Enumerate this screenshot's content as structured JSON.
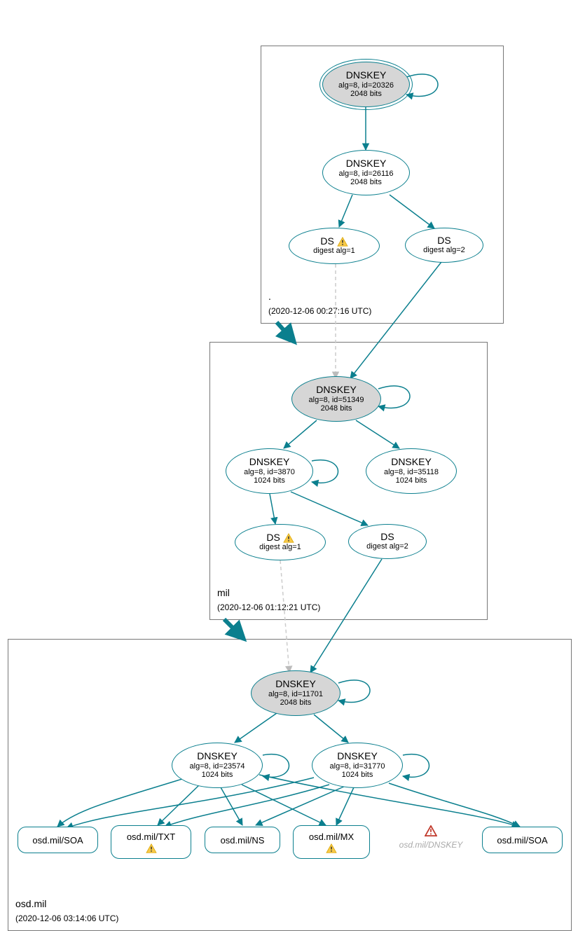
{
  "zones": {
    "root": {
      "label": ".",
      "timestamp": "(2020-12-06 00:27:16 UTC)"
    },
    "mil": {
      "label": "mil",
      "timestamp": "(2020-12-06 01:12:21 UTC)"
    },
    "osd": {
      "label": "osd.mil",
      "timestamp": "(2020-12-06 03:14:06 UTC)"
    }
  },
  "nodes": {
    "root_ksk": {
      "title": "DNSKEY",
      "line1": "alg=8, id=20326",
      "line2": "2048 bits"
    },
    "root_zsk": {
      "title": "DNSKEY",
      "line1": "alg=8, id=26116",
      "line2": "2048 bits"
    },
    "root_ds1": {
      "title": "DS",
      "line1": "digest alg=1"
    },
    "root_ds2": {
      "title": "DS",
      "line1": "digest alg=2"
    },
    "mil_ksk": {
      "title": "DNSKEY",
      "line1": "alg=8, id=51349",
      "line2": "2048 bits"
    },
    "mil_zsk1": {
      "title": "DNSKEY",
      "line1": "alg=8, id=3870",
      "line2": "1024 bits"
    },
    "mil_zsk2": {
      "title": "DNSKEY",
      "line1": "alg=8, id=35118",
      "line2": "1024 bits"
    },
    "mil_ds1": {
      "title": "DS",
      "line1": "digest alg=1"
    },
    "mil_ds2": {
      "title": "DS",
      "line1": "digest alg=2"
    },
    "osd_ksk": {
      "title": "DNSKEY",
      "line1": "alg=8, id=11701",
      "line2": "2048 bits"
    },
    "osd_zsk1": {
      "title": "DNSKEY",
      "line1": "alg=8, id=23574",
      "line2": "1024 bits"
    },
    "osd_zsk2": {
      "title": "DNSKEY",
      "line1": "alg=8, id=31770",
      "line2": "1024 bits"
    },
    "rr_soa1": {
      "label": "osd.mil/SOA"
    },
    "rr_txt": {
      "label": "osd.mil/TXT"
    },
    "rr_ns": {
      "label": "osd.mil/NS"
    },
    "rr_mx": {
      "label": "osd.mil/MX"
    },
    "rr_dnskey_err": {
      "label": "osd.mil/DNSKEY"
    },
    "rr_soa2": {
      "label": "osd.mil/SOA"
    }
  }
}
